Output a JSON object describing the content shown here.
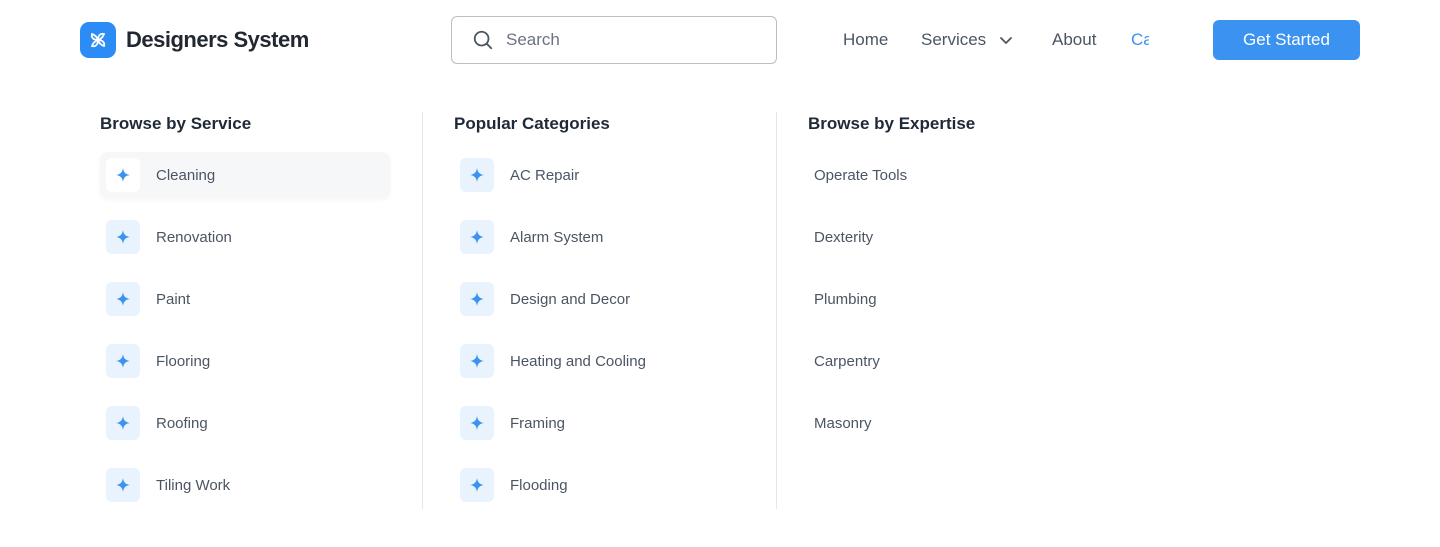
{
  "brand": {
    "name": "Designers System",
    "logo_icon": "flower-logo-icon",
    "accent": "#2b8cf5"
  },
  "search": {
    "placeholder": "Search",
    "value": ""
  },
  "nav": {
    "home": "Home",
    "services": "Services",
    "about": "About",
    "clipped_item": "Ca"
  },
  "cta": {
    "label": "Get Started",
    "color": "#3b92f0"
  },
  "columns": {
    "service": {
      "title": "Browse by Service",
      "items": [
        "Cleaning",
        "Renovation",
        "Paint",
        "Flooring",
        "Roofing",
        "Tiling Work"
      ],
      "active": "Cleaning"
    },
    "categories": {
      "title": "Popular Categories",
      "items": [
        "AC Repair",
        "Alarm System",
        "Design and Decor",
        "Heating and Cooling",
        "Framing",
        "Flooding"
      ]
    },
    "expertise": {
      "title": "Browse by Expertise",
      "items": [
        "Operate Tools",
        "Dexterity",
        "Plumbing",
        "Carpentry",
        "Masonry"
      ]
    }
  },
  "icons": {
    "item_icon": "sparkle-icon",
    "search_icon": "search-icon",
    "chevron": "chevron-down-icon"
  }
}
